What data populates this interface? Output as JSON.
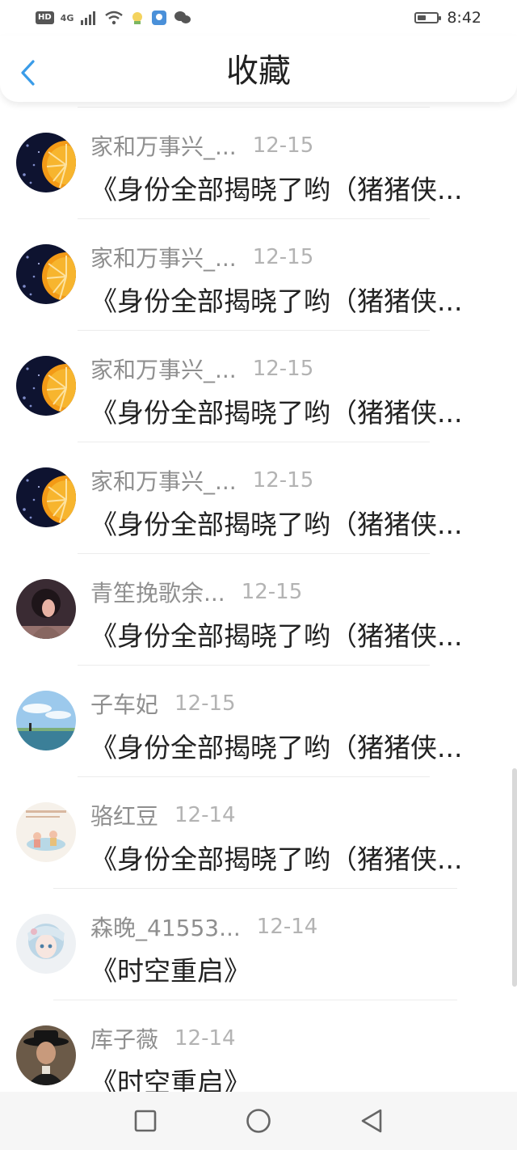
{
  "status_bar": {
    "hd": "HD",
    "network": "4G",
    "time": "8:42",
    "battery_level": 0.45
  },
  "header": {
    "title": "收藏"
  },
  "items": [
    {
      "name": "家和万事兴_...",
      "date": "12-15",
      "title": "《身份全部揭晓了哟（猪猪侠...",
      "avatar": "orange-slice-avatar"
    },
    {
      "name": "家和万事兴_...",
      "date": "12-15",
      "title": "《身份全部揭晓了哟（猪猪侠...",
      "avatar": "orange-slice-avatar"
    },
    {
      "name": "家和万事兴_...",
      "date": "12-15",
      "title": "《身份全部揭晓了哟（猪猪侠...",
      "avatar": "orange-slice-avatar"
    },
    {
      "name": "家和万事兴_...",
      "date": "12-15",
      "title": "《身份全部揭晓了哟（猪猪侠...",
      "avatar": "orange-slice-avatar"
    },
    {
      "name": "青笙挽歌余...",
      "date": "12-15",
      "title": "《身份全部揭晓了哟（猪猪侠...",
      "avatar": "dark-portrait-avatar"
    },
    {
      "name": "子车妃",
      "date": "12-15",
      "title": "《身份全部揭晓了哟（猪猪侠...",
      "avatar": "sky-landscape-avatar"
    },
    {
      "name": "骆红豆",
      "date": "12-14",
      "title": "《身份全部揭晓了哟（猪猪侠...",
      "avatar": "illustration-avatar"
    },
    {
      "name": "森晚_41553...",
      "date": "12-14",
      "title": "《时空重启》",
      "avatar": "anime-girl-avatar"
    },
    {
      "name": "库子薇",
      "date": "12-14",
      "title": "《时空重启》",
      "avatar": "hat-man-avatar"
    }
  ],
  "colors": {
    "accent": "#3a9ce8",
    "name_text": "#8f8f8f",
    "date_text": "#b3b3b3",
    "title_text": "#222222"
  },
  "nav": [
    "recent-apps-icon",
    "home-icon",
    "back-triangle-icon"
  ]
}
